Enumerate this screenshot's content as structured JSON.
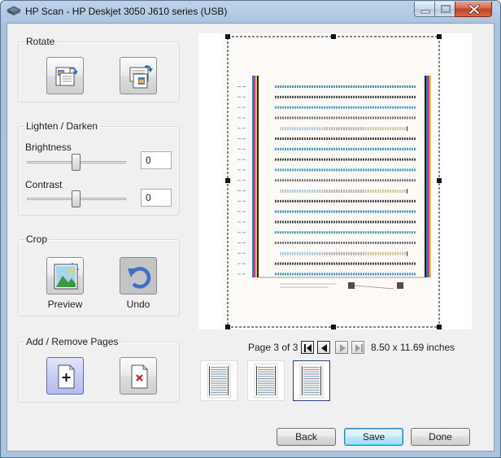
{
  "window": {
    "title": "HP Scan - HP Deskjet 3050 J610 series (USB)"
  },
  "rotate": {
    "title": "Rotate",
    "left_icon": "rotate-left-icon",
    "right_icon": "rotate-right-icon"
  },
  "adjust": {
    "title": "Lighten / Darken",
    "brightness": {
      "label": "Brightness",
      "value": "0",
      "level_fraction": 0.5
    },
    "contrast": {
      "label": "Contrast",
      "value": "0",
      "level_fraction": 0.5
    }
  },
  "crop": {
    "title": "Crop",
    "preview_label": "Preview",
    "undo_label": "Undo"
  },
  "pages": {
    "title": "Add / Remove Pages",
    "add_icon": "add-page-icon",
    "remove_icon": "remove-page-icon"
  },
  "pager": {
    "page_label": "Page 3 of 3",
    "size_label": "8.50 x 11.69 inches",
    "current_page": 3,
    "total_pages": 3
  },
  "footer": {
    "back_label": "Back",
    "save_label": "Save",
    "done_label": "Done"
  }
}
